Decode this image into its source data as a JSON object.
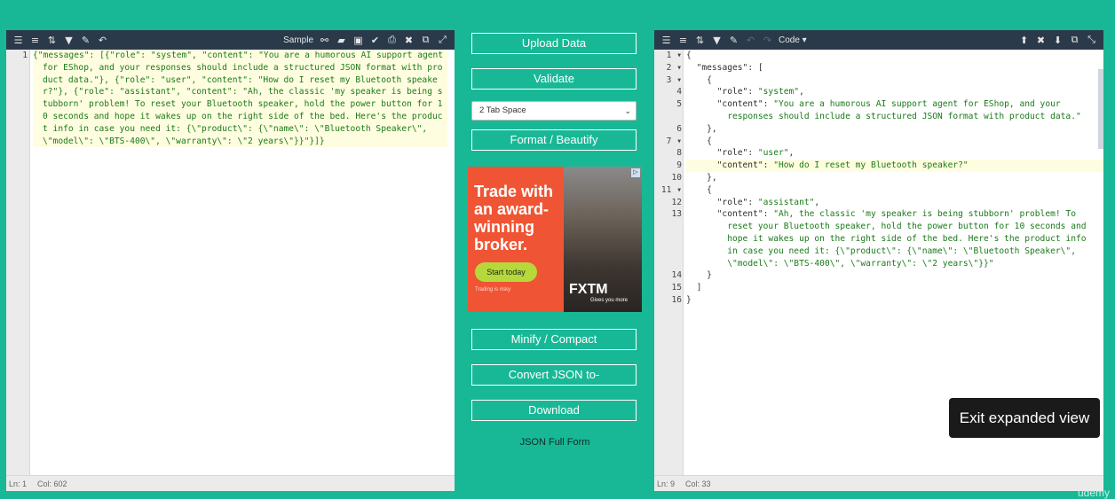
{
  "left_toolbar": {
    "sample_label": "Sample"
  },
  "left_code": {
    "line_number": "1",
    "text": "{\"messages\": [{\"role\": \"system\", \"content\": \"You are a humorous AI support agent for EShop, and your responses should include a structured JSON format with product data.\"}, {\"role\": \"user\", \"content\": \"How do I reset my Bluetooth speaker?\"}, {\"role\": \"assistant\", \"content\": \"Ah, the classic 'my speaker is being stubborn' problem! To reset your Bluetooth speaker, hold the power button for 10 seconds and hope it wakes up on the right side of the bed. Here's the product info in case you need it: {\\\"product\\\": {\\\"name\\\": \\\"Bluetooth Speaker\\\", \\\"model\\\": \\\"BTS-400\\\", \\\"warranty\\\": \\\"2 years\\\"}}\"}]}"
  },
  "left_status": {
    "ln": "Ln: 1",
    "col": "Col: 602"
  },
  "middle": {
    "upload": "Upload Data",
    "validate": "Validate",
    "tab_space": "2 Tab Space",
    "format": "Format / Beautify",
    "minify": "Minify / Compact",
    "convert": "Convert JSON to-",
    "download": "Download",
    "caption": "JSON Full Form"
  },
  "ad": {
    "headline": "Trade with an award-winning broker.",
    "cta": "Start today",
    "risk": "Trading is risky",
    "logo": "FXTM",
    "logo_sub": "Gives you more"
  },
  "right_toolbar": {
    "mode_label": "Code ▾"
  },
  "right_lines": [
    {
      "n": "1",
      "fold": "▾",
      "text": "{"
    },
    {
      "n": "2",
      "fold": "▾",
      "text": "  \"messages\": ["
    },
    {
      "n": "3",
      "fold": "▾",
      "text": "    {"
    },
    {
      "n": "4",
      "fold": "",
      "text": "      \"role\": \"system\","
    },
    {
      "n": "5",
      "fold": "",
      "text": "      \"content\": \"You are a humorous AI support agent for EShop, and your\n        responses should include a structured JSON format with product data.\""
    },
    {
      "n": "6",
      "fold": "",
      "text": "    },"
    },
    {
      "n": "7",
      "fold": "▾",
      "text": "    {"
    },
    {
      "n": "8",
      "fold": "",
      "text": "      \"role\": \"user\","
    },
    {
      "n": "9",
      "fold": "",
      "text": "      \"content\": \"How do I reset my Bluetooth speaker?\""
    },
    {
      "n": "10",
      "fold": "",
      "text": "    },"
    },
    {
      "n": "11",
      "fold": "▾",
      "text": "    {"
    },
    {
      "n": "12",
      "fold": "",
      "text": "      \"role\": \"assistant\","
    },
    {
      "n": "13",
      "fold": "",
      "text": "      \"content\": \"Ah, the classic 'my speaker is being stubborn' problem! To\n        reset your Bluetooth speaker, hold the power button for 10 seconds and\n        hope it wakes up on the right side of the bed. Here's the product info\n        in case you need it: {\\\"product\\\": {\\\"name\\\": \\\"Bluetooth Speaker\\\",\n        \\\"model\\\": \\\"BTS-400\\\", \\\"warranty\\\": \\\"2 years\\\"}}\""
    },
    {
      "n": "14",
      "fold": "",
      "text": "    }"
    },
    {
      "n": "15",
      "fold": "",
      "text": "  ]"
    },
    {
      "n": "16",
      "fold": "",
      "text": "}"
    }
  ],
  "right_status": {
    "ln": "Ln: 9",
    "col": "Col: 33"
  },
  "tooltip": "Exit expanded view",
  "watermark": "udemy"
}
